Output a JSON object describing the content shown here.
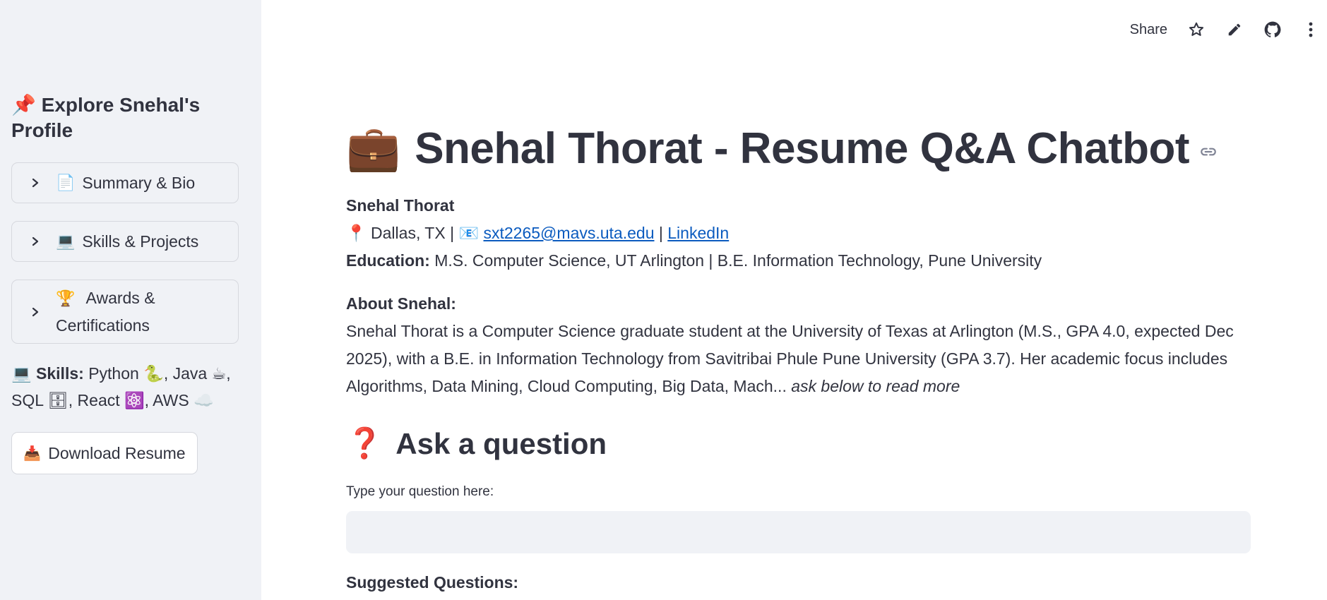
{
  "sidebar": {
    "title_emoji": "📌",
    "title": "Explore Snehal's Profile",
    "expanders": [
      {
        "emoji": "📄",
        "label": "Summary & Bio"
      },
      {
        "emoji": "💻",
        "label": "Skills & Projects"
      },
      {
        "emoji": "🏆",
        "label": "Awards & Certifications"
      }
    ],
    "skills": {
      "emoji": "💻",
      "label": "Skills:",
      "text": "Python 🐍, Java ☕, SQL 🗄, React ⚛️, AWS ☁️"
    },
    "download": {
      "emoji": "📥",
      "label": "Download Resume"
    }
  },
  "toolbar": {
    "share_label": "Share",
    "icons": [
      "star-icon",
      "edit-icon",
      "github-icon",
      "more-vertical-icon"
    ]
  },
  "main": {
    "title_emoji": "💼",
    "title": "Snehal Thorat - Resume Q&A Chatbot",
    "name": "Snehal Thorat",
    "location_emoji": "📍",
    "location": "Dallas, TX |",
    "email_emoji": "📧",
    "email": "sxt2265@mavs.uta.edu",
    "separator": "|",
    "linkedin": "LinkedIn",
    "education_label": "Education:",
    "education": "M.S. Computer Science, UT Arlington | B.E. Information Technology, Pune University",
    "about_label": "About Snehal:",
    "about_text": "Snehal Thorat is a Computer Science graduate student at the University of Texas at Arlington (M.S., GPA 4.0, expected Dec 2025), with a B.E. in Information Technology from Savitribai Phule Pune University (GPA 3.7). Her academic focus includes Algorithms, Data Mining, Cloud Computing, Big Data, Mach...",
    "about_more": "ask below to read more",
    "ask_emoji": "❓",
    "ask_title": "Ask a question",
    "question_label": "Type your question here:",
    "question_value": "",
    "suggested_label": "Suggested Questions:"
  }
}
